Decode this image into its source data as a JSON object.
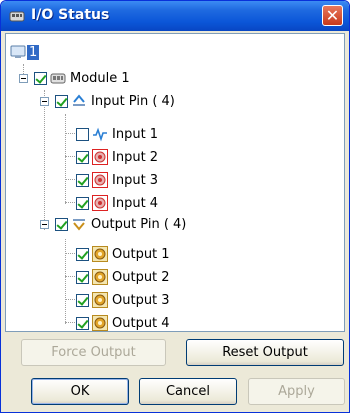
{
  "window": {
    "title": "I/O Status"
  },
  "tree": {
    "root_label": "1",
    "module": {
      "label": "Module 1"
    },
    "input_pin": {
      "label": "Input Pin ( 4)"
    },
    "inputs": [
      {
        "label": "Input 1",
        "checked": false
      },
      {
        "label": "Input 2",
        "checked": true
      },
      {
        "label": "Input 3",
        "checked": true
      },
      {
        "label": "Input 4",
        "checked": true
      }
    ],
    "output_pin": {
      "label": "Output Pin ( 4)"
    },
    "outputs": [
      {
        "label": "Output 1",
        "checked": true
      },
      {
        "label": "Output 2",
        "checked": true
      },
      {
        "label": "Output 3",
        "checked": true
      },
      {
        "label": "Output 4",
        "checked": true
      }
    ]
  },
  "buttons": {
    "force_output": "Force Output",
    "reset_output": "Reset Output",
    "ok": "OK",
    "cancel": "Cancel",
    "apply": "Apply"
  },
  "colors": {
    "titlebar": "#0b56d8",
    "close": "#c8391b",
    "check": "#21a121",
    "selection": "#316ac5"
  }
}
